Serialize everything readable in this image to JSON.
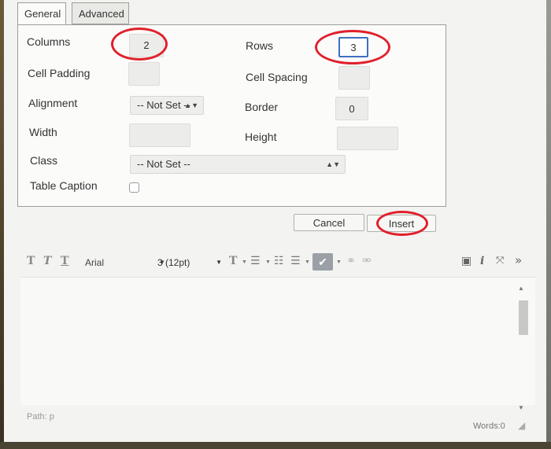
{
  "tabs": {
    "general": "General",
    "advanced": "Advanced"
  },
  "form": {
    "columns_label": "Columns",
    "columns_value": "2",
    "rows_label": "Rows",
    "rows_value": "3",
    "cell_padding_label": "Cell Padding",
    "cell_padding_value": "",
    "cell_spacing_label": "Cell Spacing",
    "cell_spacing_value": "",
    "alignment_label": "Alignment",
    "alignment_value": "-- Not Set --",
    "border_label": "Border",
    "border_value": "0",
    "width_label": "Width",
    "width_value": "",
    "height_label": "Height",
    "height_value": "",
    "class_label": "Class",
    "class_value": "-- Not Set --",
    "caption_label": "Table Caption",
    "caption_checked": false
  },
  "buttons": {
    "cancel": "Cancel",
    "insert": "Insert"
  },
  "toolbar": {
    "font_family": "Arial",
    "font_size": "3 (12pt)",
    "text_color_glyph": "T"
  },
  "status": {
    "path": "Path: p",
    "words": "Words:0"
  },
  "accent_annotation_color": "#e0202c"
}
